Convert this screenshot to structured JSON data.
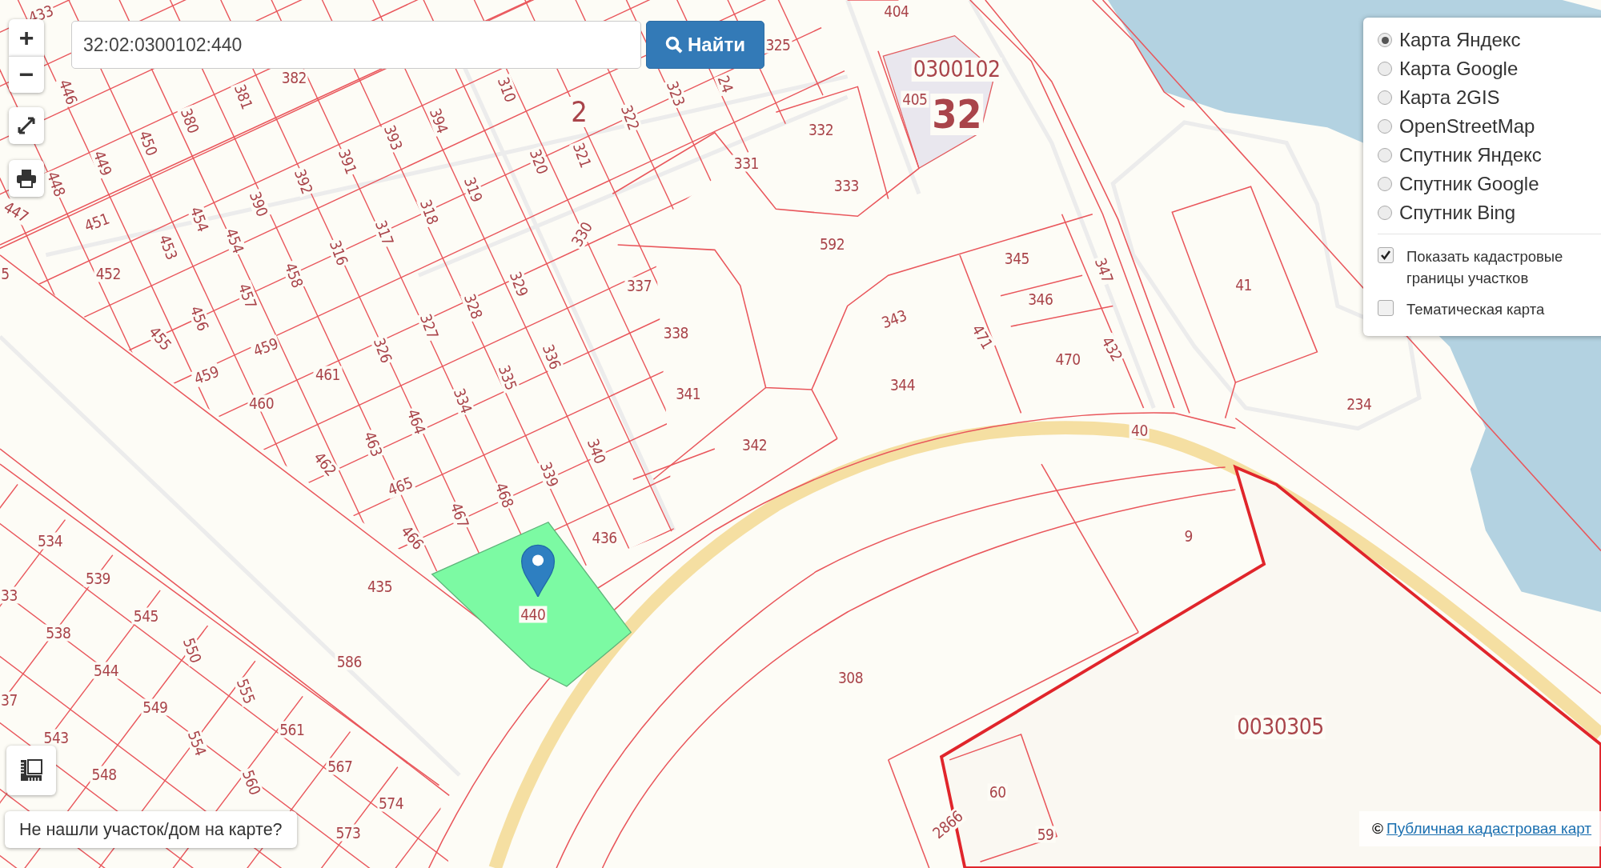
{
  "zoom": {
    "in": "+",
    "out": "−"
  },
  "search": {
    "value": "32:02:0300102:440",
    "button": "Найти"
  },
  "layers": [
    {
      "label": "Карта Яндекс",
      "selected": true
    },
    {
      "label": "Карта Google",
      "selected": false
    },
    {
      "label": "Карта 2GIS",
      "selected": false
    },
    {
      "label": "OpenStreetMap",
      "selected": false
    },
    {
      "label": "Спутник Яндекс",
      "selected": false
    },
    {
      "label": "Спутник Google",
      "selected": false
    },
    {
      "label": "Спутник Bing",
      "selected": false
    }
  ],
  "overlays": [
    {
      "label": "Показать кадастровые границы участков",
      "checked": true
    },
    {
      "label": "Тематическая карта",
      "checked": false
    }
  ],
  "help_button": "Не нашли участок/дом на карте?",
  "attribution": {
    "symbol": "©",
    "link": "Публичная кадастровая карт"
  },
  "map": {
    "labels": [
      {
        "text": "433",
        "kind": "parcel"
      },
      {
        "text": "446",
        "kind": "parcel"
      },
      {
        "text": "382",
        "kind": "parcel"
      },
      {
        "text": "381",
        "kind": "parcel"
      },
      {
        "text": "380",
        "kind": "parcel"
      },
      {
        "text": "310",
        "kind": "parcel"
      },
      {
        "text": "2",
        "kind": "block"
      },
      {
        "text": "322",
        "kind": "parcel"
      },
      {
        "text": "323",
        "kind": "parcel"
      },
      {
        "text": "24",
        "kind": "parcel"
      },
      {
        "text": "325",
        "kind": "parcel"
      },
      {
        "text": "404",
        "kind": "parcel"
      },
      {
        "text": "0300102",
        "kind": "quarter"
      },
      {
        "text": "405",
        "kind": "parcel"
      },
      {
        "text": "32",
        "kind": "region"
      },
      {
        "text": "450",
        "kind": "parcel"
      },
      {
        "text": "449",
        "kind": "parcel"
      },
      {
        "text": "448",
        "kind": "parcel"
      },
      {
        "text": "447",
        "kind": "parcel"
      },
      {
        "text": "394",
        "kind": "parcel"
      },
      {
        "text": "393",
        "kind": "parcel"
      },
      {
        "text": "391",
        "kind": "parcel"
      },
      {
        "text": "392",
        "kind": "parcel"
      },
      {
        "text": "390",
        "kind": "parcel"
      },
      {
        "text": "320",
        "kind": "parcel"
      },
      {
        "text": "321",
        "kind": "parcel"
      },
      {
        "text": "332",
        "kind": "parcel"
      },
      {
        "text": "331",
        "kind": "parcel"
      },
      {
        "text": "333",
        "kind": "parcel"
      },
      {
        "text": "319",
        "kind": "parcel"
      },
      {
        "text": "318",
        "kind": "parcel"
      },
      {
        "text": "451",
        "kind": "parcel"
      },
      {
        "text": "454",
        "kind": "parcel"
      },
      {
        "text": "454",
        "kind": "parcel"
      },
      {
        "text": "453",
        "kind": "parcel"
      },
      {
        "text": "317",
        "kind": "parcel"
      },
      {
        "text": "330",
        "kind": "parcel"
      },
      {
        "text": "592",
        "kind": "parcel"
      },
      {
        "text": "345",
        "kind": "parcel"
      },
      {
        "text": "347",
        "kind": "parcel"
      },
      {
        "text": "41",
        "kind": "parcel"
      },
      {
        "text": "5",
        "kind": "parcel"
      },
      {
        "text": "452",
        "kind": "parcel"
      },
      {
        "text": "316",
        "kind": "parcel"
      },
      {
        "text": "458",
        "kind": "parcel"
      },
      {
        "text": "329",
        "kind": "parcel"
      },
      {
        "text": "337",
        "kind": "parcel"
      },
      {
        "text": "346",
        "kind": "parcel"
      },
      {
        "text": "457",
        "kind": "parcel"
      },
      {
        "text": "328",
        "kind": "parcel"
      },
      {
        "text": "343",
        "kind": "parcel"
      },
      {
        "text": "456",
        "kind": "parcel"
      },
      {
        "text": "327",
        "kind": "parcel"
      },
      {
        "text": "338",
        "kind": "parcel"
      },
      {
        "text": "471",
        "kind": "parcel"
      },
      {
        "text": "455",
        "kind": "parcel"
      },
      {
        "text": "459",
        "kind": "parcel"
      },
      {
        "text": "326",
        "kind": "parcel"
      },
      {
        "text": "336",
        "kind": "parcel"
      },
      {
        "text": "470",
        "kind": "parcel"
      },
      {
        "text": "432",
        "kind": "parcel"
      },
      {
        "text": "461",
        "kind": "parcel"
      },
      {
        "text": "459",
        "kind": "parcel"
      },
      {
        "text": "335",
        "kind": "parcel"
      },
      {
        "text": "344",
        "kind": "parcel"
      },
      {
        "text": "341",
        "kind": "parcel"
      },
      {
        "text": "460",
        "kind": "parcel"
      },
      {
        "text": "334",
        "kind": "parcel"
      },
      {
        "text": "234",
        "kind": "parcel"
      },
      {
        "text": "464",
        "kind": "parcel"
      },
      {
        "text": "40",
        "kind": "parcel"
      },
      {
        "text": "463",
        "kind": "parcel"
      },
      {
        "text": "342",
        "kind": "parcel"
      },
      {
        "text": "340",
        "kind": "parcel"
      },
      {
        "text": "462",
        "kind": "parcel"
      },
      {
        "text": "339",
        "kind": "parcel"
      },
      {
        "text": "465",
        "kind": "parcel"
      },
      {
        "text": "468",
        "kind": "parcel"
      },
      {
        "text": "467",
        "kind": "parcel"
      },
      {
        "text": "466",
        "kind": "parcel"
      },
      {
        "text": "436",
        "kind": "parcel"
      },
      {
        "text": "9",
        "kind": "parcel"
      },
      {
        "text": "534",
        "kind": "parcel"
      },
      {
        "text": "539",
        "kind": "parcel"
      },
      {
        "text": "435",
        "kind": "parcel"
      },
      {
        "text": "33",
        "kind": "parcel"
      },
      {
        "text": "440",
        "kind": "parcel"
      },
      {
        "text": "545",
        "kind": "parcel"
      },
      {
        "text": "538",
        "kind": "parcel"
      },
      {
        "text": "550",
        "kind": "parcel"
      },
      {
        "text": "586",
        "kind": "parcel"
      },
      {
        "text": "544",
        "kind": "parcel"
      },
      {
        "text": "308",
        "kind": "parcel"
      },
      {
        "text": "555",
        "kind": "parcel"
      },
      {
        "text": "37",
        "kind": "parcel"
      },
      {
        "text": "549",
        "kind": "parcel"
      },
      {
        "text": "561",
        "kind": "parcel"
      },
      {
        "text": "0030305",
        "kind": "quarter"
      },
      {
        "text": "543",
        "kind": "parcel"
      },
      {
        "text": "554",
        "kind": "parcel"
      },
      {
        "text": "567",
        "kind": "parcel"
      },
      {
        "text": "548",
        "kind": "parcel"
      },
      {
        "text": "560",
        "kind": "parcel"
      },
      {
        "text": "60",
        "kind": "parcel"
      },
      {
        "text": "574",
        "kind": "parcel"
      },
      {
        "text": "2866",
        "kind": "parcel"
      },
      {
        "text": "573",
        "kind": "parcel"
      },
      {
        "text": "59",
        "kind": "parcel"
      }
    ]
  }
}
